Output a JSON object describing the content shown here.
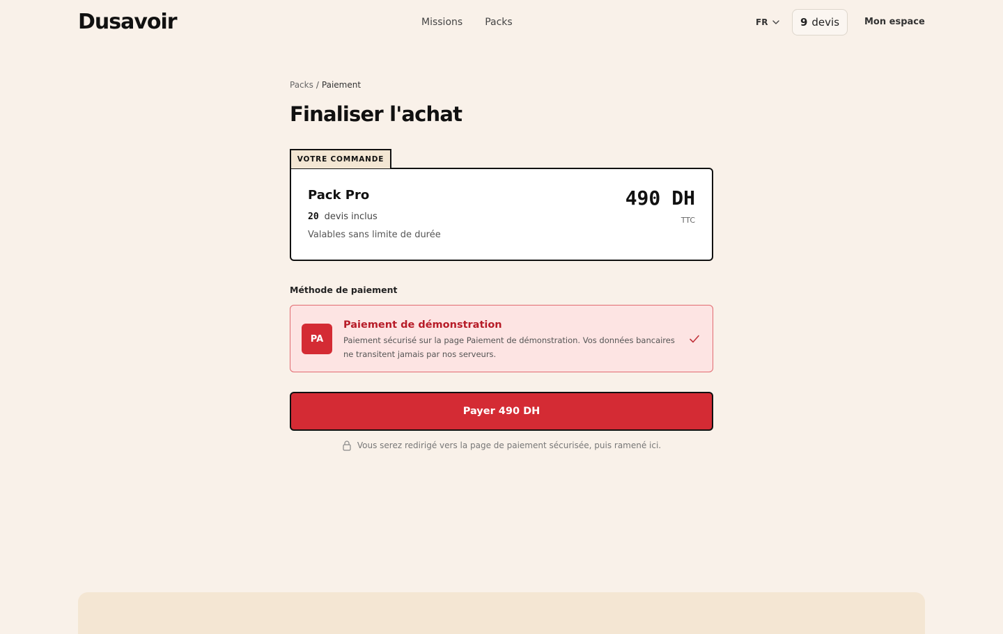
{
  "header": {
    "logo": "Dusavoir",
    "nav": [
      {
        "label": "Missions"
      },
      {
        "label": "Packs"
      }
    ],
    "language": "FR",
    "credits": {
      "count": "9",
      "unit": "devis"
    },
    "account_label": "Mon espace"
  },
  "breadcrumb": {
    "parent": "Packs",
    "separator": "/",
    "current": "Paiement"
  },
  "page_title": "Finaliser l'achat",
  "order": {
    "tab_label": "VOTRE COMMANDE",
    "pack_name": "Pack Pro",
    "quota_count": "20",
    "quota_label": "devis inclus",
    "validity": "Valables sans limite de durée",
    "price_amount": "490",
    "price_currency": "DH",
    "price_tax": "TTC"
  },
  "payment": {
    "section_label": "Méthode de paiement",
    "method": {
      "badge": "PA",
      "title": "Paiement de démonstration",
      "description": "Paiement sécurisé sur la page Paiement de démonstration. Vos données bancaires ne transitent jamais par nos serveurs.",
      "selected": true
    },
    "pay_button_label": "Payer 490 DH",
    "secure_note": "Vous serez redirigé vers la page de paiement sécurisée, puis ramené ici."
  },
  "icons": {
    "language_chevron": "chevron-down-icon",
    "check": "check-icon",
    "lock": "lock-icon"
  },
  "colors": {
    "background": "#f9f1e9",
    "accent": "#d42b34",
    "accent_dark": "#b71c28",
    "method_bg": "#fde4e3",
    "tab_bg": "#f3e6d3"
  }
}
